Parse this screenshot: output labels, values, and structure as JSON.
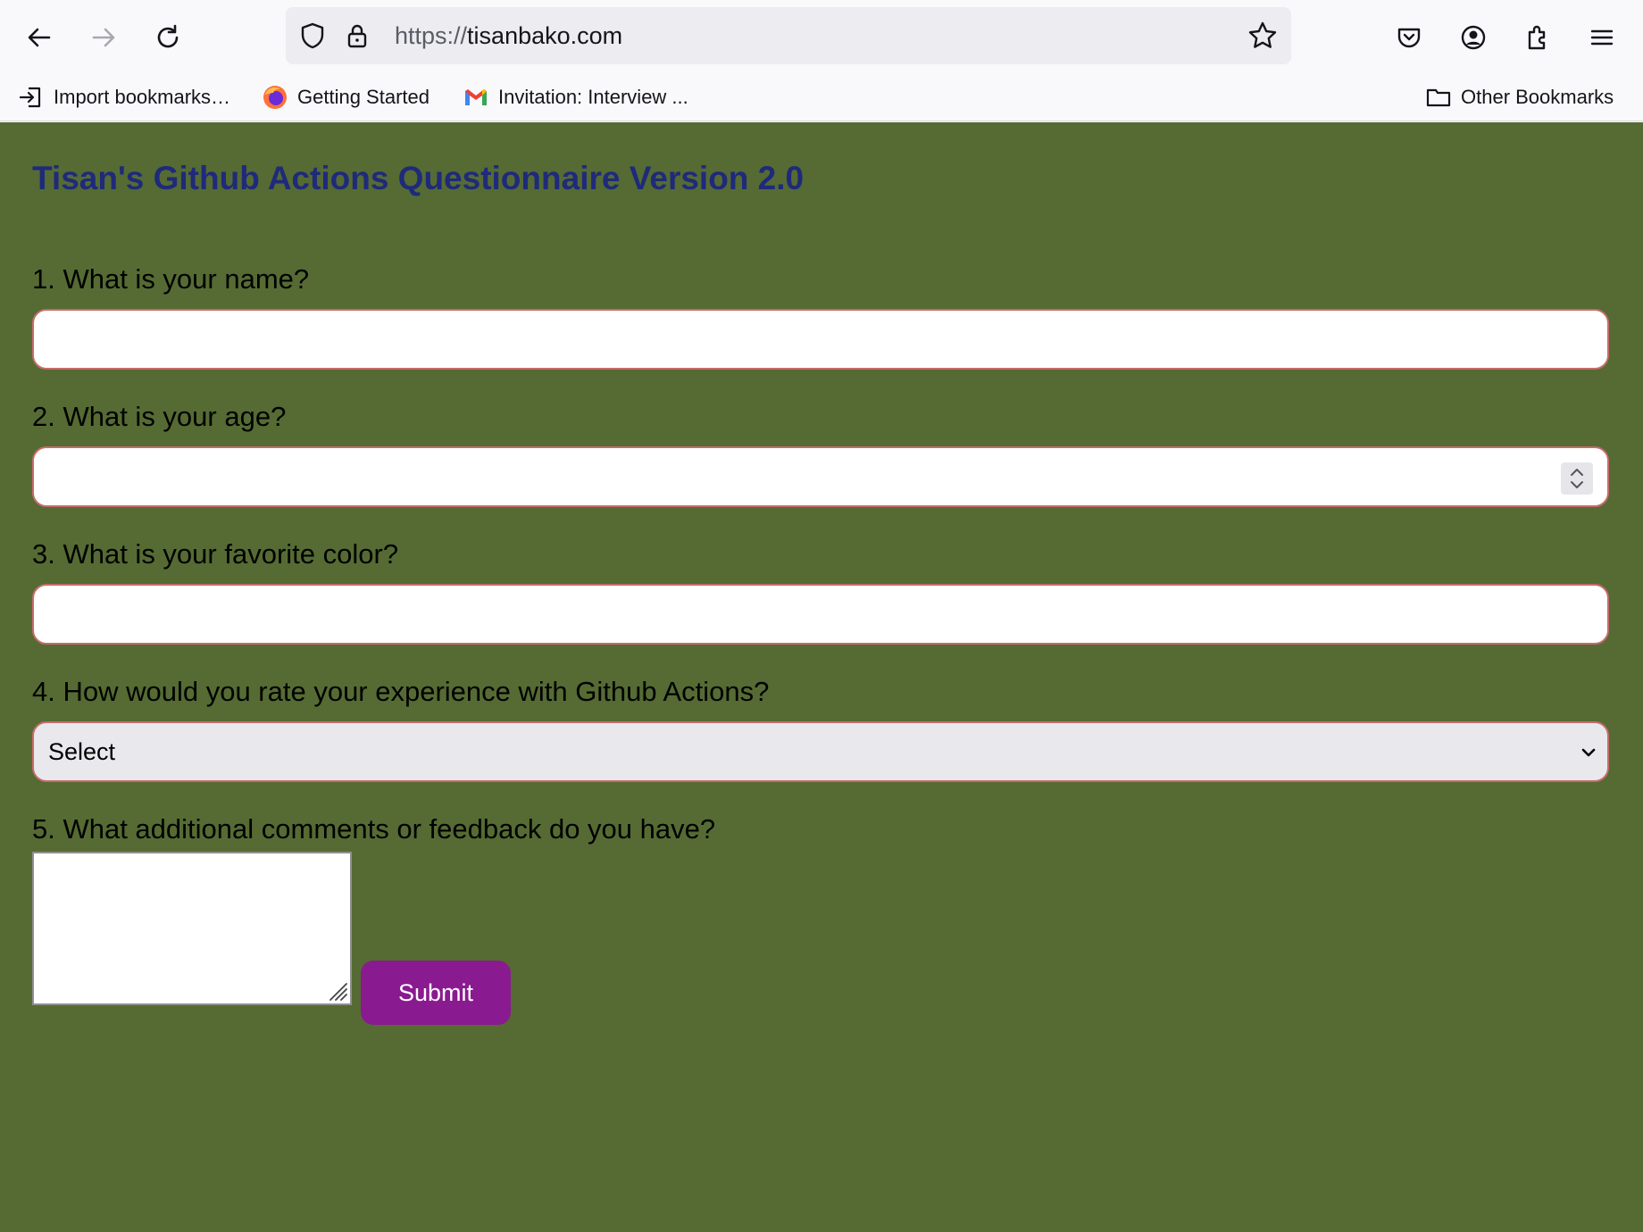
{
  "browser": {
    "url_scheme": "https://",
    "url_host": "tisanbako.com",
    "bookmarks": [
      {
        "label": "Import bookmarks…"
      },
      {
        "label": "Getting Started"
      },
      {
        "label": "Invitation: Interview ..."
      }
    ],
    "other_bookmarks_label": "Other Bookmarks"
  },
  "page": {
    "title": "Tisan's Github Actions Questionnaire Version 2.0",
    "background_color": "#556b33",
    "title_color": "#1f2a7a",
    "questions": [
      {
        "label": "1. What is your name?",
        "value": ""
      },
      {
        "label": "2. What is your age?",
        "value": ""
      },
      {
        "label": "3. What is your favorite color?",
        "value": ""
      },
      {
        "label": "4. How would you rate your experience with Github Actions?",
        "selected": "Select"
      },
      {
        "label": "5. What additional comments or feedback do you have?",
        "value": ""
      }
    ],
    "submit_label": "Submit",
    "submit_color": "#8a1a8f"
  }
}
